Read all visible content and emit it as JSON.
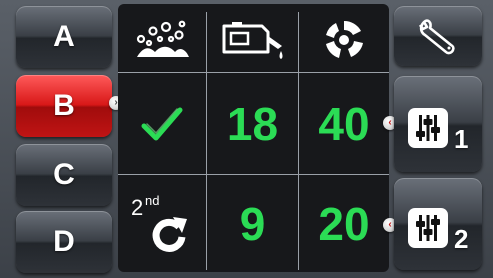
{
  "programs": [
    {
      "label": "A",
      "active": false
    },
    {
      "label": "B",
      "active": true
    },
    {
      "label": "C",
      "active": false
    },
    {
      "label": "D",
      "active": false
    }
  ],
  "grid": {
    "row1": {
      "status": "check",
      "value_mid": "18",
      "value_right": "40"
    },
    "row2": {
      "second_label": "2",
      "second_suffix": "nd",
      "value_mid": "9",
      "value_right": "20"
    }
  },
  "side": {
    "preset1_label": "1",
    "preset2_label": "2"
  },
  "colors": {
    "accent_green": "#2bdc55",
    "active_red": "#d81818",
    "panel_bg": "#17181b"
  },
  "icons": {
    "col1_header": "detergent-bubbles-icon",
    "col2_header": "oil-can-icon",
    "col3_header": "spin-rotor-icon",
    "tools": "wrench-icon",
    "preset": "sliders-icon",
    "repeat": "redo-arrow-icon"
  }
}
